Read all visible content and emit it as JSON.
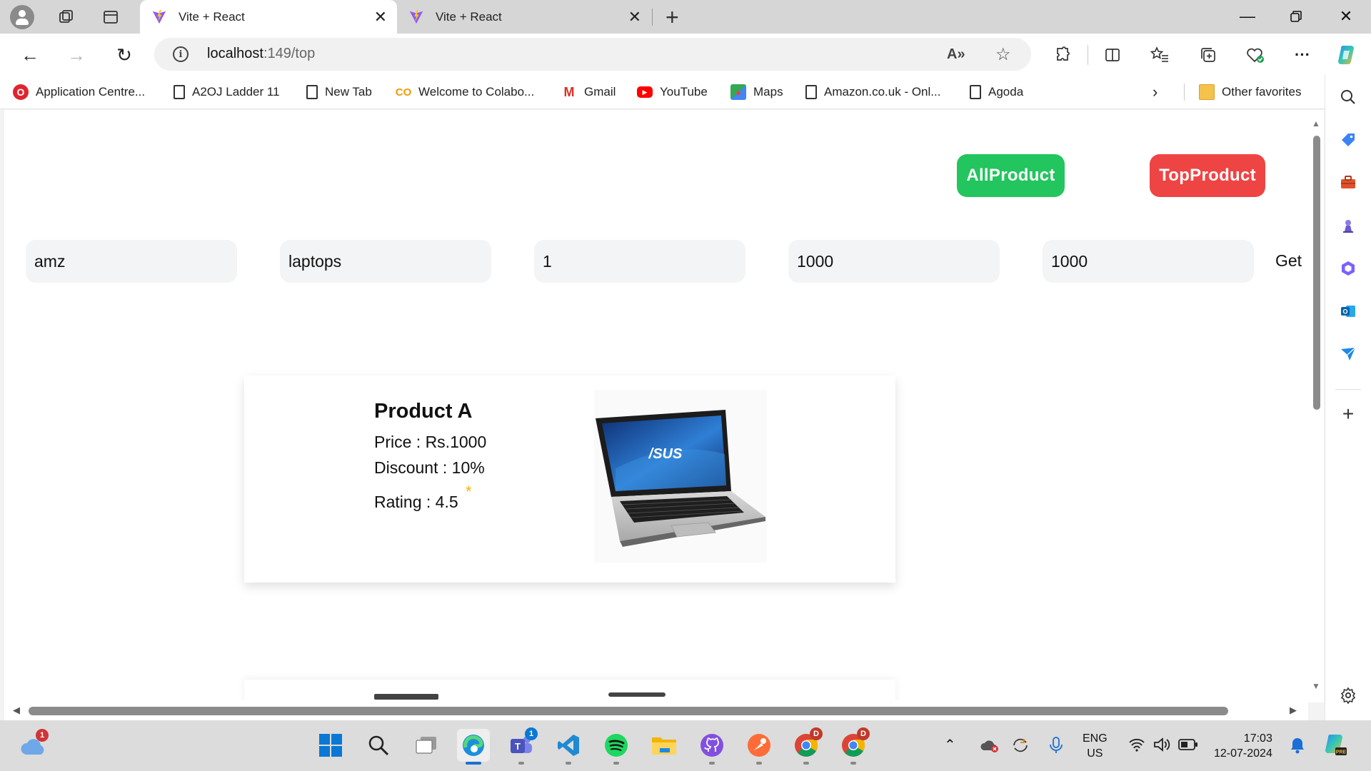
{
  "browser": {
    "tabs": [
      {
        "title": "Vite + React",
        "active": true
      },
      {
        "title": "Vite + React",
        "active": false
      }
    ],
    "address": {
      "host": "localhost",
      "path": ":149/top"
    },
    "bookmarks": [
      {
        "label": "Application Centre...",
        "icon": "opera-icon"
      },
      {
        "label": "A2OJ Ladder 11",
        "icon": "page-icon"
      },
      {
        "label": "New Tab",
        "icon": "page-icon"
      },
      {
        "label": "Welcome to Colabo...",
        "icon": "colab-icon"
      },
      {
        "label": "Gmail",
        "icon": "gmail-icon"
      },
      {
        "label": "YouTube",
        "icon": "youtube-icon"
      },
      {
        "label": "Maps",
        "icon": "maps-icon"
      },
      {
        "label": "Amazon.co.uk - Onl...",
        "icon": "page-icon"
      },
      {
        "label": "Agoda",
        "icon": "page-icon"
      }
    ],
    "other_favorites": "Other favorites"
  },
  "page": {
    "buttons": {
      "all": "AllProduct",
      "top": "TopProduct"
    },
    "filters": [
      {
        "name": "company",
        "value": "amz"
      },
      {
        "name": "category",
        "value": "laptops"
      },
      {
        "name": "top",
        "value": "1"
      },
      {
        "name": "min-price",
        "value": "1000"
      },
      {
        "name": "max-price",
        "value": "1000"
      }
    ],
    "get_label": "Get",
    "products": [
      {
        "name": "Product A",
        "price": "Price : Rs.1000",
        "discount": "Discount : 10%",
        "rating": "Rating : 4.5",
        "star": "*",
        "image": "laptop-asus"
      }
    ],
    "next_card_partial": "Product B"
  },
  "taskbar": {
    "weather_badge": "1",
    "teams_badge": "1",
    "chrome_badge": "D",
    "language": {
      "line1": "ENG",
      "line2": "US"
    },
    "time": "17:03",
    "date": "12-07-2024"
  },
  "colors": {
    "all_button": "#22c55e",
    "top_button": "#ef4444",
    "star": "#f5b301",
    "input_bg": "#f3f4f6"
  }
}
